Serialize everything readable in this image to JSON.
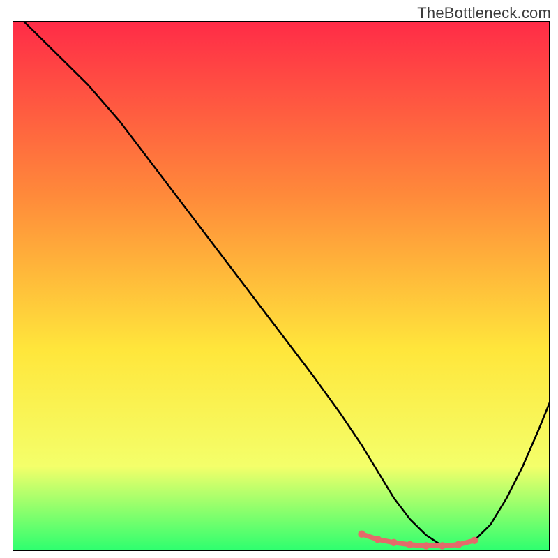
{
  "watermark": "TheBottleneck.com",
  "colors": {
    "gradient_top": "#ff2b47",
    "gradient_mid1": "#ff8a3a",
    "gradient_mid2": "#ffe63b",
    "gradient_mid3": "#f4ff6a",
    "gradient_bottom": "#2cff6f",
    "curve": "#000000",
    "highlight": "#e46a6a",
    "border": "#000000"
  },
  "chart_data": {
    "type": "line",
    "title": "",
    "xlabel": "",
    "ylabel": "",
    "xlim": [
      0,
      100
    ],
    "ylim": [
      0,
      100
    ],
    "grid": false,
    "series": [
      {
        "name": "bottleneck-curve",
        "x": [
          2,
          5,
          9,
          14,
          20,
          26,
          32,
          38,
          44,
          50,
          56,
          61,
          65,
          68,
          71,
          74,
          77,
          80,
          83,
          86,
          89,
          92,
          95,
          98,
          100
        ],
        "values": [
          100,
          97,
          93,
          88,
          81,
          73,
          65,
          57,
          49,
          41,
          33,
          26,
          20,
          15,
          10,
          6,
          3,
          1,
          1,
          2,
          5,
          10,
          16,
          23,
          28
        ]
      }
    ],
    "highlight_segment": {
      "x": [
        65,
        68,
        71,
        74,
        77,
        80,
        83,
        86
      ],
      "values": [
        3.2,
        2.2,
        1.6,
        1.2,
        1.0,
        1.0,
        1.2,
        2.0
      ]
    },
    "highlight_points": {
      "x": [
        65,
        68,
        71,
        74,
        77,
        80,
        83,
        86
      ],
      "values": [
        3.2,
        2.2,
        1.6,
        1.2,
        1.0,
        1.0,
        1.2,
        2.0
      ]
    }
  }
}
